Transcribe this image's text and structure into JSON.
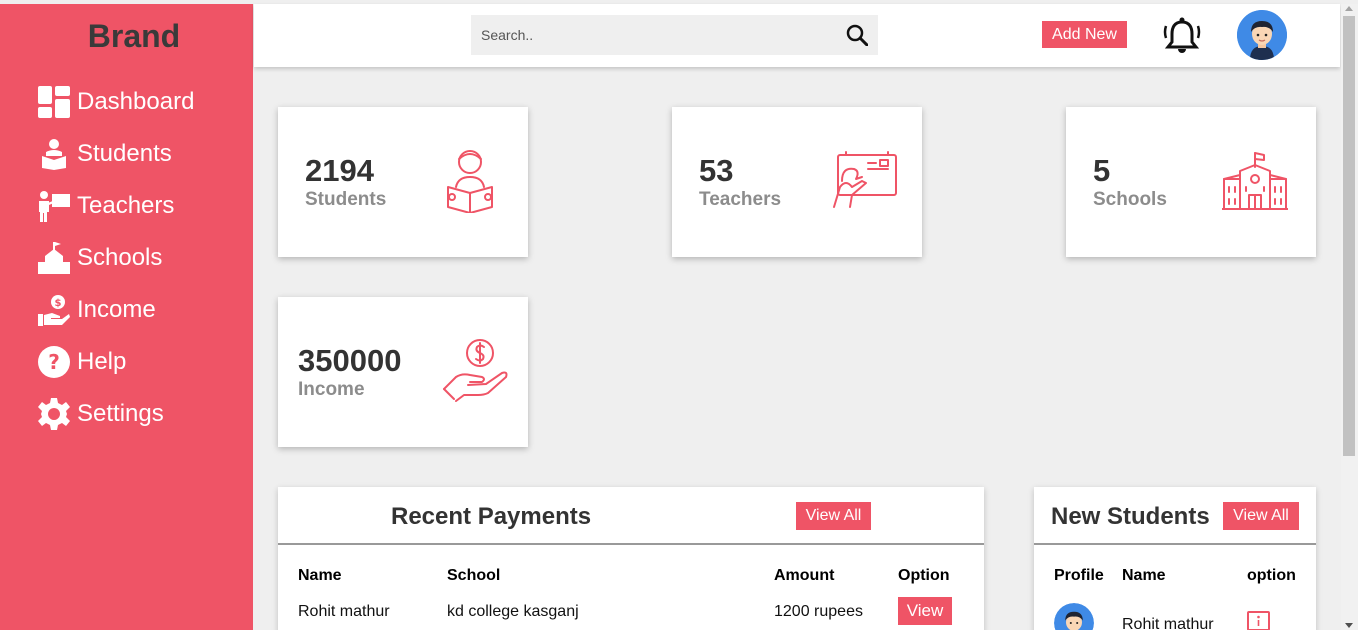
{
  "sidebar": {
    "brand": "Brand",
    "items": [
      {
        "label": "Dashboard",
        "icon": "dashboard-icon"
      },
      {
        "label": "Students",
        "icon": "student-reading-icon"
      },
      {
        "label": "Teachers",
        "icon": "teacher-board-icon"
      },
      {
        "label": "Schools",
        "icon": "school-building-icon"
      },
      {
        "label": "Income",
        "icon": "hand-dollar-icon"
      },
      {
        "label": "Help",
        "icon": "question-circle-icon"
      },
      {
        "label": "Settings",
        "icon": "gear-icon"
      }
    ]
  },
  "topbar": {
    "search_placeholder": "Search..",
    "add_label": "Add New"
  },
  "colors": {
    "accent": "#ef5466",
    "background": "#efefef",
    "text_dark": "#333333",
    "text_muted": "#8c8c8c"
  },
  "cards": [
    {
      "value": "2194",
      "label": "Students",
      "icon": "student-reading-icon"
    },
    {
      "value": "53",
      "label": "Teachers",
      "icon": "teacher-board-icon"
    },
    {
      "value": "5",
      "label": "Schools",
      "icon": "school-building-icon"
    },
    {
      "value": "350000",
      "label": "Income",
      "icon": "hand-dollar-icon"
    }
  ],
  "payments": {
    "title": "Recent Payments",
    "view_all": "View All",
    "columns": [
      "Name",
      "School",
      "Amount",
      "Option"
    ],
    "rows": [
      {
        "name": "Rohit mathur",
        "school": "kd college kasganj",
        "amount": "1200 rupees",
        "option": "View"
      }
    ]
  },
  "new_students": {
    "title": "New Students",
    "view_all": "View All",
    "columns": [
      "Profile",
      "Name",
      "option"
    ],
    "rows": [
      {
        "name": "Rohit mathur",
        "option_icon": "info-icon"
      }
    ]
  }
}
